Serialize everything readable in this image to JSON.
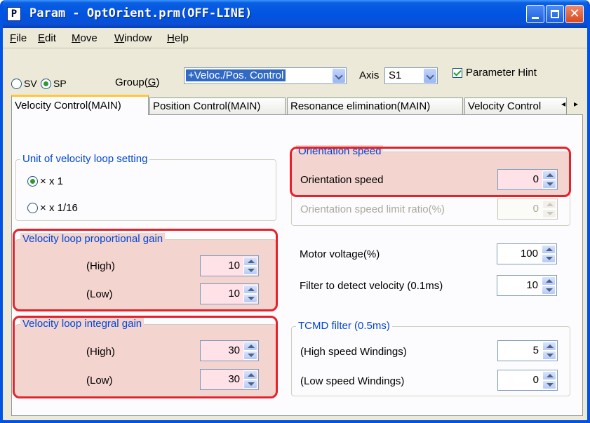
{
  "window": {
    "icon_letter": "P",
    "title": "Param - OptOrient.prm(OFF-LINE)"
  },
  "menu": [
    {
      "label": "File",
      "mnemonic": "F",
      "rest": "ile"
    },
    {
      "label": "Edit",
      "mnemonic": "E",
      "rest": "dit"
    },
    {
      "label": "Move",
      "mnemonic": "M",
      "rest": "ove"
    },
    {
      "label": "Window",
      "mnemonic": "W",
      "rest": "indow"
    },
    {
      "label": "Help",
      "mnemonic": "H",
      "rest": "elp"
    }
  ],
  "toolbar": {
    "sv_label": "SV",
    "sp_label": "SP",
    "group_label_pre": "Group(",
    "group_label_mn": "G",
    "group_label_post": ")",
    "group_value": "+Veloc./Pos. Control",
    "axis_label": "Axis",
    "axis_value": "S1",
    "hint_label": "Parameter Hint",
    "hint_checked": true,
    "selected_mode": "SP"
  },
  "tabs": [
    {
      "label": "Velocity Control(MAIN)",
      "active": true
    },
    {
      "label": "Position Control(MAIN)",
      "active": false
    },
    {
      "label": "Resonance elimination(MAIN)",
      "active": false
    },
    {
      "label": "Velocity Control",
      "active": false
    }
  ],
  "tab_scroll": {
    "left": "◂",
    "right": "▸"
  },
  "unit_group": {
    "title": "Unit of velocity loop setting",
    "options": [
      "x 1",
      "x 1/16"
    ],
    "selected": 0
  },
  "prop_gain": {
    "title": "Velocity loop proportional gain",
    "high_label": "(High)",
    "high_value": "10",
    "low_label": "(Low)",
    "low_value": "10"
  },
  "int_gain": {
    "title": "Velocity loop integral gain",
    "high_label": "(High)",
    "high_value": "30",
    "low_label": "(Low)",
    "low_value": "30"
  },
  "orientation": {
    "title": "Orientation speed",
    "speed_label": "Orientation speed",
    "speed_value": "0",
    "limit_label": "Orientation speed limit ratio(%)",
    "limit_value": "0"
  },
  "motor_voltage": {
    "label": "Motor voltage(%)",
    "value": "100"
  },
  "filter_velocity": {
    "label": "Filter to detect velocity (0.1ms)",
    "value": "10"
  },
  "tcmd": {
    "title": "TCMD filter (0.5ms)",
    "high_label": "(High speed Windings)",
    "high_value": "5",
    "low_label": "(Low speed Windings)",
    "low_value": "0"
  },
  "colors": {
    "accent_highlight": "#f3d4cf",
    "highlight_border": "#e8202a",
    "group_title": "#0046d5"
  }
}
